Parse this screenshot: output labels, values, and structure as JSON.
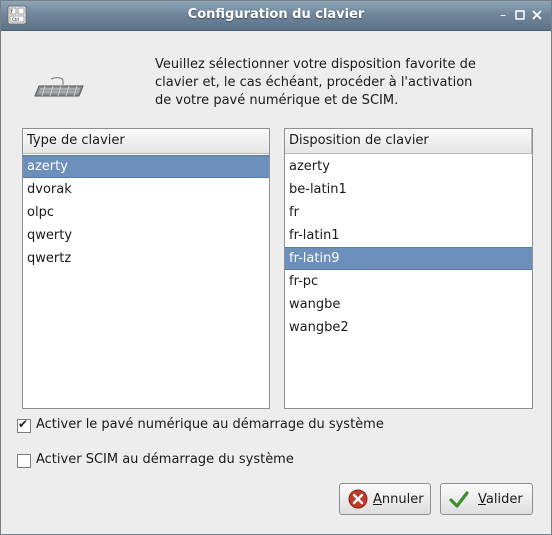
{
  "window": {
    "title": "Configuration du clavier"
  },
  "message": {
    "line1": "Veuillez sélectionner votre disposition favorite de",
    "line2": "clavier et, le cas échéant, procéder à l'activation",
    "line3": "de votre pavé numérique et de SCIM."
  },
  "keyboard_type": {
    "header": "Type de clavier",
    "items": [
      "azerty",
      "dvorak",
      "olpc",
      "qwerty",
      "qwertz"
    ],
    "selected": "azerty"
  },
  "keyboard_layout": {
    "header": "Disposition de clavier",
    "items": [
      "azerty",
      "be-latin1",
      "fr",
      "fr-latin1",
      "fr-latin9",
      "fr-pc",
      "wangbe",
      "wangbe2"
    ],
    "selected": "fr-latin9"
  },
  "options": {
    "numlock": {
      "label": "Activer le pavé numérique au démarrage du système",
      "checked": true
    },
    "scim": {
      "label": "Activer SCIM au démarrage du système",
      "checked": false
    }
  },
  "buttons": {
    "cancel": {
      "mnemonic": "A",
      "rest": "nnuler"
    },
    "ok": {
      "mnemonic": "V",
      "rest": "alider"
    }
  },
  "colors": {
    "selection": "#6d8fbc",
    "titlebar": "#6f869b",
    "cancel_icon": "#c0392b",
    "ok_icon": "#3a8f2a"
  }
}
